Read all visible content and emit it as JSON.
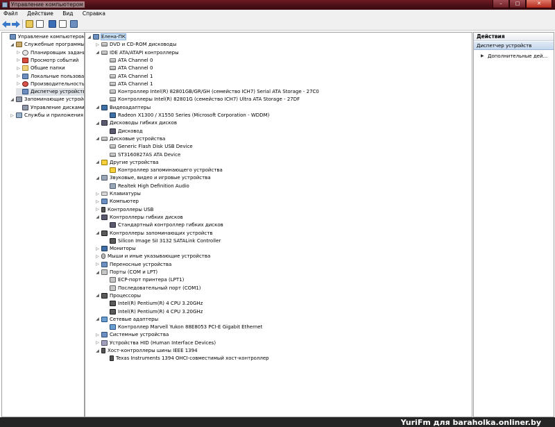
{
  "window": {
    "title": "Управление компьютером"
  },
  "menu": [
    {
      "label": "Файл"
    },
    {
      "label": "Действие"
    },
    {
      "label": "Вид"
    },
    {
      "label": "Справка"
    }
  ],
  "left_tree": [
    {
      "label": "Управление компьютером (л",
      "indent": 0,
      "icon": "comp",
      "exp": ""
    },
    {
      "label": "Служебные программы",
      "indent": 1,
      "icon": "tool",
      "exp": "◢"
    },
    {
      "label": "Планировщик заданий",
      "indent": 2,
      "icon": "clock",
      "exp": "▷"
    },
    {
      "label": "Просмотр событий",
      "indent": 2,
      "icon": "log",
      "exp": "▷"
    },
    {
      "label": "Общие папки",
      "indent": 2,
      "icon": "folder",
      "exp": "▷"
    },
    {
      "label": "Локальные пользовате",
      "indent": 2,
      "icon": "comp",
      "exp": "▷"
    },
    {
      "label": "Производительность",
      "indent": 2,
      "icon": "perf",
      "exp": "▷"
    },
    {
      "label": "Диспетчер устройств",
      "indent": 2,
      "icon": "comp",
      "exp": "",
      "selected": true
    },
    {
      "label": "Запоминающие устройст",
      "indent": 1,
      "icon": "disk",
      "exp": "◢"
    },
    {
      "label": "Управление дисками",
      "indent": 2,
      "icon": "disk",
      "exp": ""
    },
    {
      "label": "Службы и приложения",
      "indent": 1,
      "icon": "svc",
      "exp": "▷"
    }
  ],
  "device_tree": [
    {
      "label": "Елена-ПК",
      "indent": 0,
      "icon": "comp",
      "exp": "◢",
      "root": true
    },
    {
      "label": "DVD и CD-ROM дисководы",
      "indent": 1,
      "icon": "drive",
      "exp": "▷"
    },
    {
      "label": "IDE ATA/ATAPI контроллеры",
      "indent": 1,
      "icon": "drive",
      "exp": "◢"
    },
    {
      "label": "ATA Channel 0",
      "indent": 2,
      "icon": "drive",
      "exp": ""
    },
    {
      "label": "ATA Channel 0",
      "indent": 2,
      "icon": "drive",
      "exp": ""
    },
    {
      "label": "ATA Channel 1",
      "indent": 2,
      "icon": "drive",
      "exp": ""
    },
    {
      "label": "ATA Channel 1",
      "indent": 2,
      "icon": "drive",
      "exp": ""
    },
    {
      "label": "Контроллер Intel(R) 82801GB/GR/GH (семейство ICH7) Serial ATA Storage - 27C0",
      "indent": 2,
      "icon": "drive",
      "exp": ""
    },
    {
      "label": "Контроллеры Intel(R) 82801G (семейство ICH7) Ultra ATA Storage - 27DF",
      "indent": 2,
      "icon": "drive",
      "exp": ""
    },
    {
      "label": "Видеоадаптеры",
      "indent": 1,
      "icon": "monitor",
      "exp": "◢"
    },
    {
      "label": "Radeon X1300 / X1550 Series  (Microsoft Corporation - WDDM)",
      "indent": 2,
      "icon": "monitor",
      "exp": ""
    },
    {
      "label": "Дисководы гибких дисков",
      "indent": 1,
      "icon": "floppy",
      "exp": "◢"
    },
    {
      "label": "Дисковод",
      "indent": 2,
      "icon": "floppy",
      "exp": ""
    },
    {
      "label": "Дисковые устройства",
      "indent": 1,
      "icon": "drive",
      "exp": "◢"
    },
    {
      "label": "Generic Flash Disk USB Device",
      "indent": 2,
      "icon": "drive",
      "exp": ""
    },
    {
      "label": "ST3160827AS ATA Device",
      "indent": 2,
      "icon": "drive",
      "exp": ""
    },
    {
      "label": "Другие устройства",
      "indent": 1,
      "icon": "warn",
      "exp": "◢"
    },
    {
      "label": "Контроллер запоминающего устройства",
      "indent": 2,
      "icon": "warn",
      "exp": ""
    },
    {
      "label": "Звуковые, видео и игровые устройства",
      "indent": 1,
      "icon": "sound",
      "exp": "◢"
    },
    {
      "label": "Realtek High Definition Audio",
      "indent": 2,
      "icon": "sound",
      "exp": ""
    },
    {
      "label": "Клавиатуры",
      "indent": 1,
      "icon": "key",
      "exp": "▷"
    },
    {
      "label": "Компьютер",
      "indent": 1,
      "icon": "comp",
      "exp": "▷"
    },
    {
      "label": "Контроллеры USB",
      "indent": 1,
      "icon": "usb",
      "exp": "▷"
    },
    {
      "label": "Контроллеры гибких дисков",
      "indent": 1,
      "icon": "floppy",
      "exp": "◢"
    },
    {
      "label": "Стандартный контроллер гибких дисков",
      "indent": 2,
      "icon": "floppy",
      "exp": ""
    },
    {
      "label": "Контроллеры запоминающих устройств",
      "indent": 1,
      "icon": "chip",
      "exp": "◢"
    },
    {
      "label": "Silicon Image SiI 3132 SATALink Controller",
      "indent": 2,
      "icon": "chip",
      "exp": ""
    },
    {
      "label": "Мониторы",
      "indent": 1,
      "icon": "monitor",
      "exp": "▷"
    },
    {
      "label": "Мыши и иные указывающие устройства",
      "indent": 1,
      "icon": "mouse",
      "exp": "▷"
    },
    {
      "label": "Переносные устройства",
      "indent": 1,
      "icon": "comp",
      "exp": "▷"
    },
    {
      "label": "Порты (COM и LPT)",
      "indent": 1,
      "icon": "port",
      "exp": "◢"
    },
    {
      "label": "ECP-порт принтера (LPT1)",
      "indent": 2,
      "icon": "port",
      "exp": ""
    },
    {
      "label": "Последовательный порт (COM1)",
      "indent": 2,
      "icon": "port",
      "exp": ""
    },
    {
      "label": "Процессоры",
      "indent": 1,
      "icon": "chip",
      "exp": "◢"
    },
    {
      "label": "Intel(R) Pentium(R) 4 CPU 3.20GHz",
      "indent": 2,
      "icon": "chip",
      "exp": ""
    },
    {
      "label": "Intel(R) Pentium(R) 4 CPU 3.20GHz",
      "indent": 2,
      "icon": "chip",
      "exp": ""
    },
    {
      "label": "Сетевые адаптеры",
      "indent": 1,
      "icon": "net",
      "exp": "◢"
    },
    {
      "label": "Контроллер Marvell Yukon 88E8053 PCI-E Gigabit Ethernet",
      "indent": 2,
      "icon": "net",
      "exp": ""
    },
    {
      "label": "Системные устройства",
      "indent": 1,
      "icon": "comp",
      "exp": "▷"
    },
    {
      "label": "Устройства HID (Human Interface Devices)",
      "indent": 1,
      "icon": "hid",
      "exp": "▷"
    },
    {
      "label": "Хост-контроллеры шины IEEE 1394",
      "indent": 1,
      "icon": "usb",
      "exp": "◢"
    },
    {
      "label": "Texas Instruments 1394 OHCI-совместимый хост-контроллер",
      "indent": 2,
      "icon": "usb",
      "exp": ""
    }
  ],
  "actions": {
    "header": "Действия",
    "section": "Диспетчер устройств",
    "item": "Дополнительные дей..."
  },
  "watermark": "YuriFm для baraholka.onliner.by"
}
